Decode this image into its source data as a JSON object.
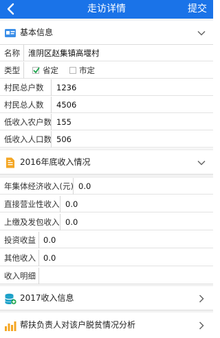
{
  "navbar": {
    "title": "走访详情",
    "submit_label": "提交",
    "back_icon": "back-arrow-icon",
    "bg_color": "#1a73e8"
  },
  "basic_info": {
    "title": "基本信息",
    "icon": "id-card-icon",
    "name_label": "名称",
    "name_value": "淮阴区赵集镇高堰村",
    "type_label": "类型",
    "type_options": [
      {
        "label": "省定",
        "checked": true
      },
      {
        "label": "市定",
        "checked": false
      }
    ],
    "households_label": "村民总户数",
    "households_value": "1236",
    "population_label": "村民总人数",
    "population_value": "4506",
    "low_income_households_label": "低收入农户数",
    "low_income_households_value": "155",
    "low_income_population_label": "低收入人口数",
    "low_income_population_value": "506"
  },
  "income_2016": {
    "title": "2016年底收入情况",
    "icon": "document-icon",
    "collective_label": "年集体经济收入(元)",
    "collective_value": "0.0",
    "operating_label": "直接营业性收入",
    "operating_value": "0.0",
    "contracting_label": "上缴及发包收入",
    "contracting_value": "0.0",
    "investment_label": "投资收益",
    "investment_value": "0.0",
    "other_label": "其他收入",
    "other_value": "0.0",
    "detail_label": "收入明细",
    "detail_value": ""
  },
  "income_2017": {
    "title": "2017收入信息",
    "icon": "database-plus-icon"
  },
  "poverty_analysis": {
    "title": "帮扶负责人对该户脱贫情况分析",
    "icon": "bar-chart-icon"
  }
}
